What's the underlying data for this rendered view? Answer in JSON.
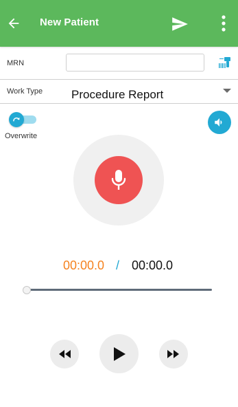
{
  "app_bar": {
    "title": "New Patient",
    "back_icon": "arrow-back-icon",
    "send_icon": "send-icon",
    "more_icon": "more-vert-icon",
    "color": "#5cb85c"
  },
  "form": {
    "mrn": {
      "label": "MRN",
      "value": "",
      "placeholder": "",
      "scan_icon": "barcode-scanner-icon"
    },
    "work_type": {
      "label": "Work Type",
      "selected": "Procedure Report"
    }
  },
  "overwrite": {
    "label": "Overwrite",
    "enabled": true,
    "icon": "redo-icon"
  },
  "volume_icon": "volume-icon",
  "mic_icon": "microphone-icon",
  "timer": {
    "elapsed": "00:00.0",
    "separator": "/",
    "total": "00:00.0"
  },
  "seek": {
    "progress": 0
  },
  "controls": {
    "rewind_icon": "rewind-icon",
    "play_icon": "play-icon",
    "fast_forward_icon": "fast-forward-icon"
  },
  "colors": {
    "accent": "#22a9d3",
    "record": "#ef5353",
    "elapsed_time": "#f5821f"
  }
}
